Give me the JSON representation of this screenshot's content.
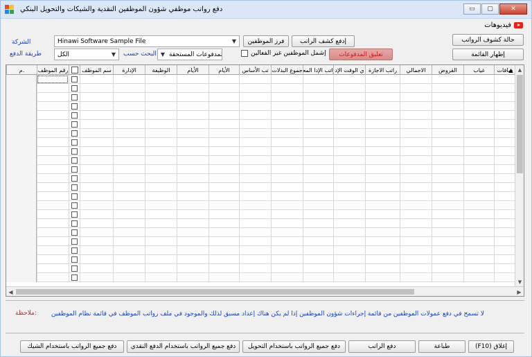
{
  "window": {
    "title": "دفع رواتب موظفي شؤون الموظفين النقدية والشيكات والتحويل البنكي"
  },
  "header": {
    "videos_label": "فيديوهات"
  },
  "controls": {
    "salary_sheet_status_button": "حالة كشوف الرواتب",
    "show_list_button": "إظهار القائمة",
    "pay_payslip_button": "إدفع كشف الراتب",
    "sort_employees_button": "فرز الموظفين",
    "suspend_payments_button": "تعليق المدفوعات",
    "company_label": "الشركة",
    "company_value": "Hinawi Software Sample File",
    "payment_method_label": "طريقة الدفع",
    "payment_method_value": "الكل",
    "search_by_label": "البحث حسب",
    "search_by_value": "المدفوعات المستحقة",
    "include_inactive_label": "إشمل الموظفين غير الفعالين"
  },
  "grid": {
    "columns": [
      "م.",
      "رقم الموظف",
      "",
      "اسم الموظف",
      "الإدارة",
      "الوظيفة",
      "الأيام",
      "الأيام",
      "الراتب الأساسي",
      "مجموع البدلات",
      "رواتب الإدارة المعلقة",
      "الوقت الإضافي",
      "راتب الاجازة",
      "الاجمالي",
      "القروض",
      "غياب",
      "خصومات"
    ],
    "column_labels_display": [
      "م.",
      "رقم الموظف",
      "",
      "سم الموظف",
      "الإدارة",
      "الوظيفة",
      "الأيام",
      "الأيام",
      "تب الأساس",
      "جموع البدلات",
      "رواتب الإدا المعلة",
      "ي الوقت الإد",
      "راتب الاجازة",
      "الاجمالي",
      "القروض",
      "غياب",
      "صافات"
    ]
  },
  "note": {
    "label": "ملاحظة:",
    "text": "لا تسمح في دفع عمولات الموظفين من قائمة إجراءات شؤون الموظفين إذا لم يكن هناك إعداد مسبق لذلك والموجود في ملف رواتب الموظف في قائمة نظام الموظفين"
  },
  "footer": {
    "close_button": "(F10) إغلاق",
    "print_button": "طباعة",
    "pay_salary_button": "دفع الراتب",
    "pay_all_transfer_button": "دفع جميع الرواتب باستخدام التحويل",
    "pay_all_cash_button": "دفع جميع الرواتب باستخدام الدفع النقدي",
    "pay_all_check_button": "دفع جميع الرواتب باستخدام الشيك"
  }
}
